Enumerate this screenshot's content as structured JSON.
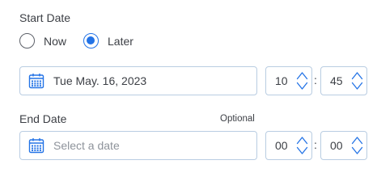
{
  "start": {
    "label": "Start Date",
    "options": [
      {
        "label": "Now",
        "selected": false
      },
      {
        "label": "Later",
        "selected": true
      }
    ],
    "date_value": "Tue May. 16, 2023",
    "hour": "10",
    "minute": "45"
  },
  "end": {
    "label": "End Date",
    "optional_label": "Optional",
    "date_placeholder": "Select a date",
    "hour": "00",
    "minute": "00"
  },
  "time_separator": ":",
  "icons": {
    "calendar": "calendar-icon",
    "stepper": "up-down-chevron-icon"
  },
  "colors": {
    "accent": "#2373e6",
    "field_border": "#b9cde2",
    "text": "#3c3f45",
    "placeholder": "#8e939b"
  }
}
